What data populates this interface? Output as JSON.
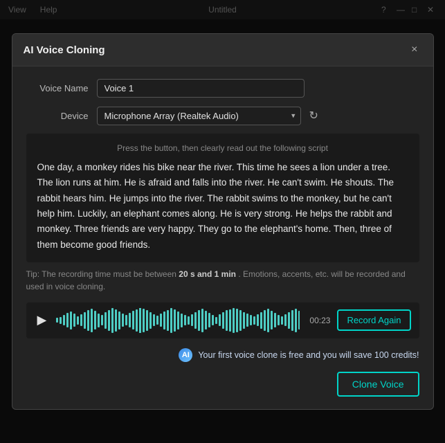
{
  "topbar": {
    "menu_items": [
      "View",
      "Help"
    ],
    "title": "Untitled",
    "icons": [
      "question-icon",
      "minimize-icon",
      "maximize-icon",
      "close-icon"
    ]
  },
  "modal": {
    "title": "AI Voice Cloning",
    "close_label": "×",
    "fields": {
      "voice_name_label": "Voice Name",
      "voice_name_value": "Voice 1",
      "device_label": "Device",
      "device_value": "Microphone Array (Realtek Audio)"
    },
    "script": {
      "hint": "Press the button, then clearly read out the following script",
      "text": "One day, a monkey rides his bike near the river. This time he sees a lion under a tree. The lion runs at him. He is afraid and falls into the river. He can't swim. He shouts. The rabbit hears him. He jumps into the river. The rabbit swims to the monkey, but he can't help him. Luckily, an elephant comes along. He is very strong. He helps the rabbit and monkey. Three friends are very happy. They go to the elephant's home. Then, three of them become good friends."
    },
    "tip": {
      "prefix": "Tip: The recording time must be between ",
      "bold": "20 s and 1 min",
      "suffix": " . Emotions, accents, etc. will be recorded and used in voice cloning."
    },
    "audio": {
      "time": "00:23",
      "play_label": "▶"
    },
    "buttons": {
      "record_again": "Record Again",
      "clone_voice": "Clone Voice"
    },
    "info_banner": {
      "ai_label": "AI",
      "text": "Your first voice clone is free and you will save 100 credits!"
    }
  }
}
